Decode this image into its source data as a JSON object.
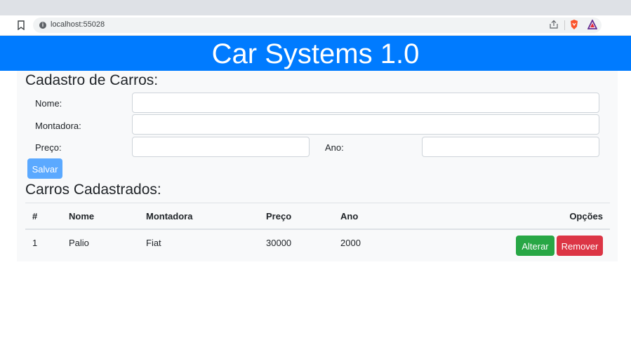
{
  "browser": {
    "url": "localhost:55028"
  },
  "app": {
    "title": "Car Systems 1.0"
  },
  "form": {
    "heading": "Cadastro de Carros:",
    "nome_label": "Nome:",
    "montadora_label": "Montadora:",
    "preco_label": "Preço:",
    "ano_label": "Ano:",
    "nome_value": "",
    "montadora_value": "",
    "preco_value": "",
    "ano_value": "",
    "save_label": "Salvar"
  },
  "list": {
    "heading": "Carros Cadastrados:",
    "columns": [
      "#",
      "Nome",
      "Montadora",
      "Preço",
      "Ano",
      "Opções"
    ],
    "rows": [
      {
        "id": "1",
        "nome": "Palio",
        "montadora": "Fiat",
        "preco": "30000",
        "ano": "2000"
      }
    ],
    "edit_label": "Alterar",
    "remove_label": "Remover"
  },
  "colors": {
    "header": "#007bff",
    "edit": "#28a745",
    "remove": "#dc3545",
    "save": "#5ba9ff"
  }
}
